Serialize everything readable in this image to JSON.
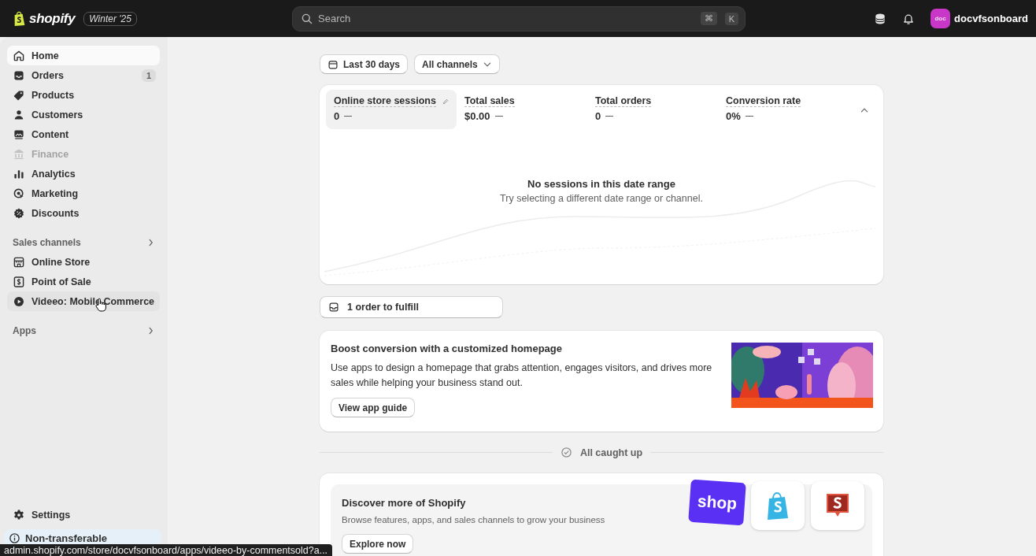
{
  "topbar": {
    "logo": "shopify",
    "edition": "Winter '25",
    "search": {
      "placeholder": "Search",
      "shortcut": [
        "⌘",
        "K"
      ]
    },
    "avatar": "doc",
    "store_name": "docvfsonboard"
  },
  "sidebar": {
    "items": [
      {
        "kind": "item",
        "label": "Home",
        "selected": true,
        "hovered": false,
        "disabled": false
      },
      {
        "kind": "item",
        "label": "Orders",
        "badge": "1",
        "selected": false,
        "hovered": false,
        "disabled": false
      },
      {
        "kind": "item",
        "label": "Products",
        "selected": false,
        "hovered": false,
        "disabled": false
      },
      {
        "kind": "item",
        "label": "Customers",
        "selected": false,
        "hovered": false,
        "disabled": false
      },
      {
        "kind": "item",
        "label": "Content",
        "selected": false,
        "hovered": false,
        "disabled": false
      },
      {
        "kind": "item",
        "label": "Finance",
        "selected": false,
        "hovered": false,
        "disabled": true
      },
      {
        "kind": "item",
        "label": "Analytics",
        "selected": false,
        "hovered": false,
        "disabled": false
      },
      {
        "kind": "item",
        "label": "Marketing",
        "selected": false,
        "hovered": false,
        "disabled": false
      },
      {
        "kind": "item",
        "label": "Discounts",
        "selected": false,
        "hovered": false,
        "disabled": false
      },
      {
        "kind": "heading",
        "label": "Sales channels"
      },
      {
        "kind": "item",
        "label": "Online Store",
        "selected": false,
        "hovered": false,
        "disabled": false
      },
      {
        "kind": "item",
        "label": "Point of Sale",
        "selected": false,
        "hovered": false,
        "disabled": false
      },
      {
        "kind": "item",
        "label": "Videeo: Mobile Commerce",
        "selected": false,
        "hovered": true,
        "disabled": false
      },
      {
        "kind": "heading",
        "label": "Apps"
      }
    ],
    "settings": "Settings",
    "banner": "Non-transferable"
  },
  "main": {
    "filters": [
      {
        "kind": "date",
        "label": "Last 30 days"
      },
      {
        "kind": "dropdown",
        "label": "All channels"
      }
    ],
    "metrics": {
      "expanded": true,
      "items": [
        {
          "label": "Online store sessions",
          "value": "0",
          "selected": true
        },
        {
          "label": "Total sales",
          "value": "$0.00",
          "selected": false
        },
        {
          "label": "Total orders",
          "value": "0",
          "selected": false
        },
        {
          "label": "Conversion rate",
          "value": "0%",
          "selected": false
        }
      ],
      "empty_title": "No sessions in this date range",
      "empty_text": "Try selecting a different date range or channel."
    },
    "task": "1 order to fulfill",
    "promo": {
      "title": "Boost conversion with a customized homepage",
      "text": "Use apps to design a homepage that grabs attention, engages visitors, and drives more sales while helping your business stand out.",
      "button": "View app guide"
    },
    "caught_up": "All caught up",
    "discover": {
      "title": "Discover more of Shopify",
      "text": "Browse features, apps, and sales channels to grow your business",
      "button": "Explore now",
      "shop_logo": "shop"
    }
  },
  "status_bar": "admin.shopify.com/store/docvfsonboard/apps/videeo-by-commentsold?a..."
}
